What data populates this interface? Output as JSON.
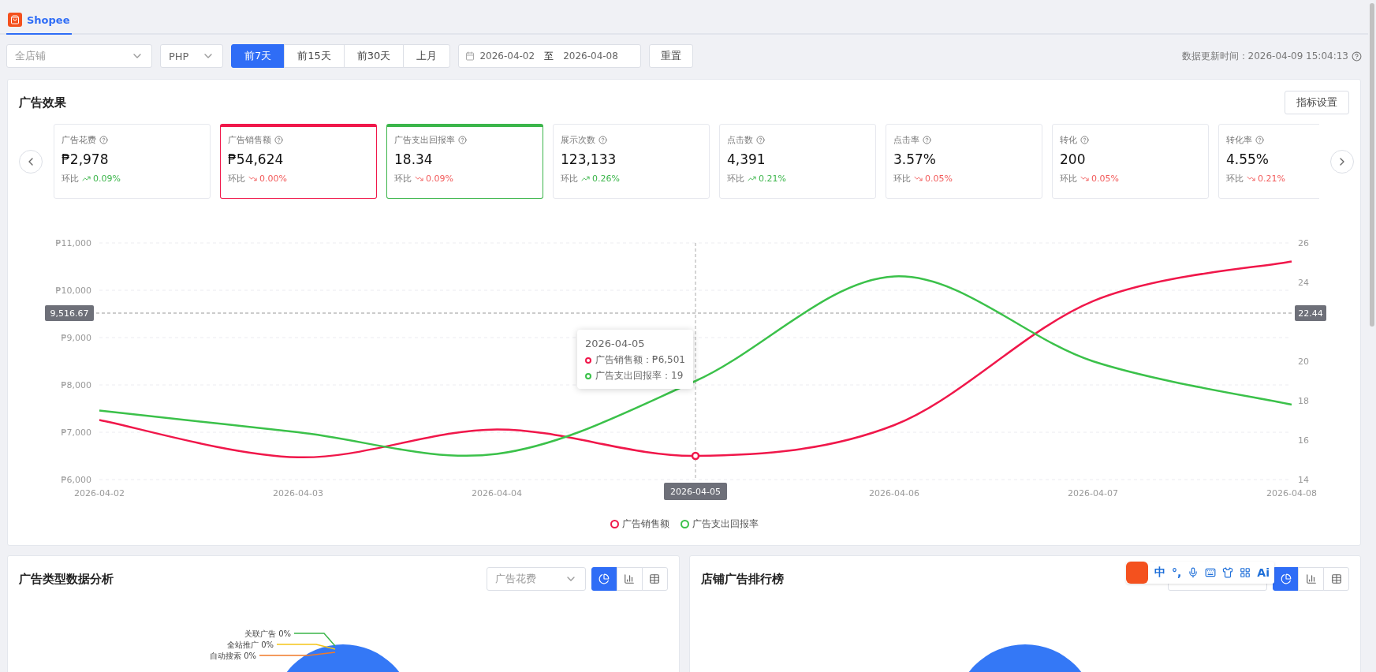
{
  "tabs": [
    {
      "label": "Shopee",
      "selected": true
    }
  ],
  "filters": {
    "shop_select": {
      "placeholder": "全店铺"
    },
    "currency_select": {
      "value": "PHP"
    },
    "periods": [
      {
        "label": "前7天",
        "selected": true
      },
      {
        "label": "前15天",
        "selected": false
      },
      {
        "label": "前30天",
        "selected": false
      },
      {
        "label": "上月",
        "selected": false
      }
    ],
    "date_range": {
      "start": "2026-04-02",
      "separator": "至",
      "end": "2026-04-08"
    },
    "reset_button": "重置",
    "update_time": "数据更新时间：2026-04-09 15:04:13"
  },
  "ad_effect": {
    "title": "广告效果",
    "settings_button": "指标设置",
    "metrics": [
      {
        "label": "广告花费",
        "value": "₱2,978",
        "change_label": "环比",
        "change": "0.09%",
        "rising": true,
        "selected": false
      },
      {
        "label": "广告销售额",
        "value": "₱54,624",
        "change_label": "环比",
        "change": "0.00%",
        "rising": false,
        "selected": true,
        "color": "#f0174a"
      },
      {
        "label": "广告支出回报率",
        "value": "18.34",
        "change_label": "环比",
        "change": "0.09%",
        "rising": false,
        "selected": true,
        "color": "#3bb54a"
      },
      {
        "label": "展示次数",
        "value": "123,133",
        "change_label": "环比",
        "change": "0.26%",
        "rising": true,
        "selected": false
      },
      {
        "label": "点击数",
        "value": "4,391",
        "change_label": "环比",
        "change": "0.21%",
        "rising": true,
        "selected": false
      },
      {
        "label": "点击率",
        "value": "3.57%",
        "change_label": "环比",
        "change": "0.05%",
        "rising": false,
        "selected": false
      },
      {
        "label": "转化",
        "value": "200",
        "change_label": "环比",
        "change": "0.05%",
        "rising": false,
        "selected": false
      },
      {
        "label": "转化率",
        "value": "4.55%",
        "change_label": "环比",
        "change": "0.21%",
        "rising": false,
        "selected": false
      }
    ],
    "chart_data": {
      "type": "line",
      "grid": true,
      "x": [
        "2026-04-02",
        "2026-04-03",
        "2026-04-04",
        "2026-04-05",
        "2026-04-06",
        "2026-04-07",
        "2026-04-08"
      ],
      "series": [
        {
          "name": "广告销售额",
          "color": "#f0174a",
          "values": [
            7260,
            6470,
            7060,
            6501,
            7150,
            9770,
            10610
          ]
        },
        {
          "name": "广告支出回报率",
          "color": "#3bc14a",
          "axis": "y2",
          "values": [
            17.5,
            16.4,
            15.3,
            19,
            24.3,
            20,
            17.8
          ]
        }
      ],
      "ylim": [
        6000,
        11000
      ],
      "yticks": [
        {
          "value": 6000,
          "label": "₱6,000"
        },
        {
          "value": 7000,
          "label": "₱7,000"
        },
        {
          "value": 8000,
          "label": "₱8,000"
        },
        {
          "value": 9000,
          "label": "₱9,000"
        },
        {
          "value": 10000,
          "label": "₱10,000"
        },
        {
          "value": 11000,
          "label": "₱11,000"
        }
      ],
      "y2lim": [
        14,
        26
      ],
      "y2ticks": [
        14,
        16,
        18,
        20,
        24,
        26
      ],
      "ref_lines": [
        {
          "axis": "y",
          "value": 9516.67,
          "label": "9,516.67"
        },
        {
          "axis": "x",
          "value": "2026-04-05",
          "label": "2026-04-05"
        }
      ],
      "annotations": [
        "22.44"
      ]
    },
    "tooltip": {
      "title": "2026-04-05",
      "items": [
        "广告销售额：₱6,501",
        "广告支出回报率：19"
      ]
    }
  },
  "panels": [
    {
      "title": "广告类型数据分析",
      "metric_select": {
        "placeholder": "广告花费"
      },
      "views": [
        {
          "kind": "pie",
          "selected": true
        },
        {
          "kind": "bar",
          "selected": false
        },
        {
          "kind": "table",
          "selected": false
        }
      ],
      "pie_labels": [
        {
          "text": "关联广告 0%",
          "color": "#3bb54a"
        },
        {
          "text": "全站推广 0%",
          "color": "#f5c518"
        },
        {
          "text": "自动搜索 0%",
          "color": "#f07a2a"
        }
      ]
    },
    {
      "title": "店铺广告排行榜",
      "views": [
        {
          "kind": "pie",
          "selected": true
        },
        {
          "kind": "bar",
          "selected": false
        },
        {
          "kind": "table",
          "selected": false
        }
      ]
    }
  ],
  "ime_toolbar": {
    "lang": "中",
    "punct": "°,",
    "ai": "Ai"
  }
}
